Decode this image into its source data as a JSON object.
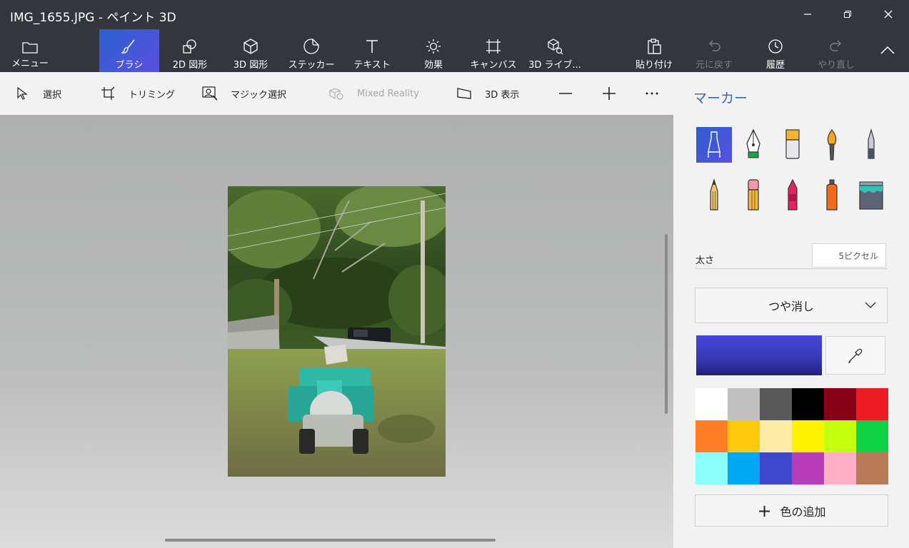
{
  "window": {
    "title": "IMG_1655.JPG - ペイント 3D"
  },
  "toolbar": {
    "menu": "メニュー",
    "brushes": "ブラシ",
    "shapes2d": "2D 図形",
    "shapes3d": "3D 図形",
    "stickers": "ステッカー",
    "text": "テキスト",
    "effects": "効果",
    "canvas": "キャンバス",
    "library3d": "3D ライブ...",
    "paste": "貼り付け",
    "undo": "元に戻す",
    "history": "履歴",
    "redo": "やり直し"
  },
  "subtoolbar": {
    "select": "選択",
    "crop": "トリミング",
    "magic_select": "マジック選択",
    "mixed_reality": "Mixed Reality",
    "view3d": "3D 表示"
  },
  "panel": {
    "title": "マーカー",
    "thickness_label": "太さ",
    "thickness_value": "5ピクセル",
    "finish": "つや消し",
    "add_color": "色の追加",
    "current_color": "#4646d8",
    "palette": [
      "#ffffff",
      "#c0c0c0",
      "#595959",
      "#000000",
      "#880015",
      "#ed1c24",
      "#ff7f27",
      "#ffc90e",
      "#fdeca6",
      "#fff200",
      "#c4ff0e",
      "#0ed145",
      "#8cfffb",
      "#00a8f3",
      "#3f48cc",
      "#b83dba",
      "#ffaec8",
      "#b97a57"
    ]
  }
}
